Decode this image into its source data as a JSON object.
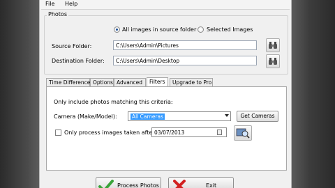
{
  "menu": {
    "file": "File",
    "help": "Help"
  },
  "photos_group": {
    "legend": "Photos",
    "radio_all": "All images in source folder",
    "radio_selected": "Selected Images",
    "source_label": "Source Folder:",
    "source_value": "C:\\Users\\Admin\\Pictures",
    "dest_label": "Destination Folder:",
    "dest_value": "C:\\Users\\Admin\\Desktop"
  },
  "tabs": [
    "Time Difference",
    "Options",
    "Advanced",
    "Filters",
    "Upgrade to Pro"
  ],
  "filters": {
    "intro": "Only include photos matching this criteria:",
    "camera_label": "Camera (Make/Model):",
    "camera_value": "All Cameras",
    "get_cameras": "Get Cameras",
    "date_check_label": "Only process images taken after:",
    "date_value": "03/07/2013"
  },
  "actions": {
    "process": "Process Photos",
    "exit": "Exit"
  },
  "colors": {
    "selection": "#3399ff",
    "check_green": "#3aa33a",
    "exit_red": "#d22020"
  }
}
